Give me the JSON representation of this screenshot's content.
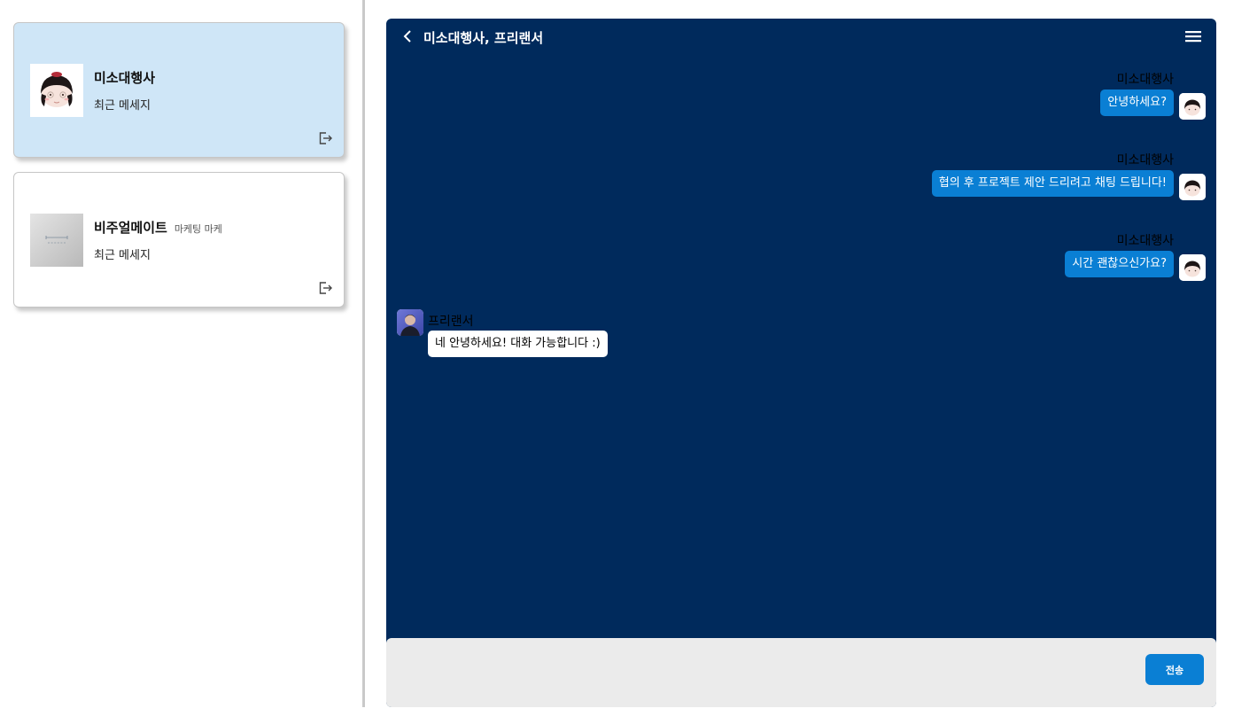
{
  "rooms": [
    {
      "name": "미소대행사",
      "tag": "",
      "last_message": "최근 메세지",
      "active": true
    },
    {
      "name": "비주얼메이트",
      "tag": "마케팅 마케",
      "last_message": "최근 메세지",
      "active": false
    }
  ],
  "chat": {
    "title": "미소대행사, 프리랜서",
    "messages": [
      {
        "sender": "미소대행사",
        "text": "안녕하세요?",
        "mine": true
      },
      {
        "sender": "미소대행사",
        "text": "협의 후 프로젝트 제안 드리려고 채팅 드립니다!",
        "mine": true
      },
      {
        "sender": "미소대행사",
        "text": "시간 괜찮으신가요?",
        "mine": true
      },
      {
        "sender": "프리랜서",
        "text": "네 안녕하세요! 대화 가능합니다 :)",
        "mine": false
      }
    ],
    "input_placeholder": "",
    "send_label": "전송"
  },
  "icons": {
    "back": "chevron-left-icon",
    "menu": "hamburger-menu-icon",
    "leave": "exit-room-icon"
  },
  "colors": {
    "chat_background": "#002a5c",
    "my_bubble": "#0a7fd4",
    "active_room": "#cfe6f7",
    "input_area": "#ebebeb"
  }
}
